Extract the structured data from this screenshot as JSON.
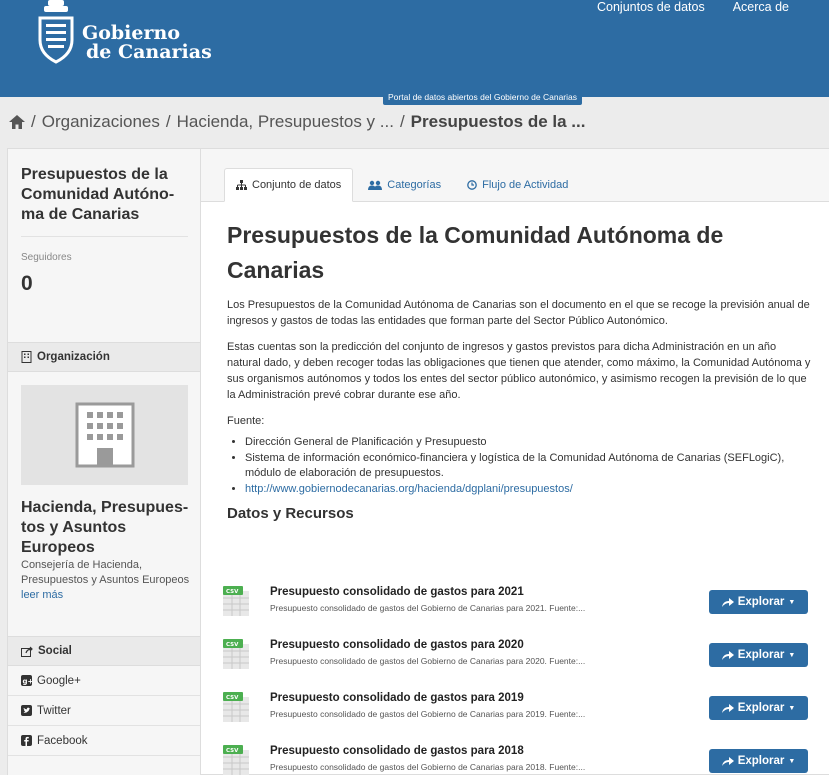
{
  "header": {
    "logo_line1": "Gobierno",
    "logo_line2": "de Canarias",
    "nav": [
      "Conjuntos de datos",
      "Acerca de"
    ],
    "site_tag": "Portal de datos abiertos del Gobierno de Canarias"
  },
  "breadcrumb": {
    "home_icon": "home-icon",
    "items": [
      "Organizaciones",
      "Hacienda, Presupuestos y ...",
      "Presupuestos de la ..."
    ]
  },
  "sidebar": {
    "dataset_title": "Presupuestos de la Comunidad Autóno-ma de Canarias",
    "followers_label": "Seguidores",
    "followers_value": "0",
    "org_section": "Organización",
    "org_name": "Hacienda, Presupues-tos y Asuntos Europeos",
    "org_desc": "Consejería de Hacienda, Presupuestos y Asuntos Europeos",
    "org_more": "leer más",
    "social_section": "Social",
    "social_items": [
      "Google+",
      "Twitter",
      "Facebook"
    ]
  },
  "tabs": [
    "Conjunto de datos",
    "Categorías",
    "Flujo de Actividad"
  ],
  "content": {
    "title": "Presupuestos de la Comunidad Autónoma de Canarias",
    "para1": "Los Presupuestos de la Comunidad Autónoma de Canarias son el documento en el que se recoge la previsión anual de ingresos y gastos de todas las entidades que forman parte del Sector Público Autonómico.",
    "para2": "Estas cuentas son la predicción del conjunto de ingresos y gastos previstos para dicha Administración en un año natural dado, y deben recoger todas las obligaciones que tienen que atender, como máximo, la Comunidad Autónoma y sus organismos autónomos y todos los entes del sector público autonómico, y asimismo recogen la previsión de lo que la Administración prevé cobrar durante ese año.",
    "source_label": "Fuente:",
    "sources": [
      "Dirección General de Planificación y Presupuesto",
      "Sistema de información económico-financiera y logística de la Comunidad Autónoma de Canarias (SEFLogiC), módulo de elaboración de presupuestos.",
      "http://www.gobiernodecanarias.org/hacienda/dgplani/presupuestos/"
    ],
    "resources_heading": "Datos y Recursos",
    "explore_label": "Explorar",
    "resources": [
      {
        "title": "Presupuesto consolidado de gastos para 2021",
        "desc": "Presupuesto consolidado de gastos del Gobierno de Canarias para 2021. Fuente:..."
      },
      {
        "title": "Presupuesto consolidado de gastos para 2020",
        "desc": "Presupuesto consolidado de gastos del Gobierno de Canarias para 2020. Fuente:..."
      },
      {
        "title": "Presupuesto consolidado de gastos para 2019",
        "desc": "Presupuesto consolidado de gastos del Gobierno de Canarias para 2019. Fuente:..."
      },
      {
        "title": "Presupuesto consolidado de gastos para 2018",
        "desc": "Presupuesto consolidado de gastos del Gobierno de Canarias para 2018. Fuente:..."
      }
    ]
  },
  "colors": {
    "brand": "#2d6ca3",
    "csv_green": "#4caf50"
  }
}
